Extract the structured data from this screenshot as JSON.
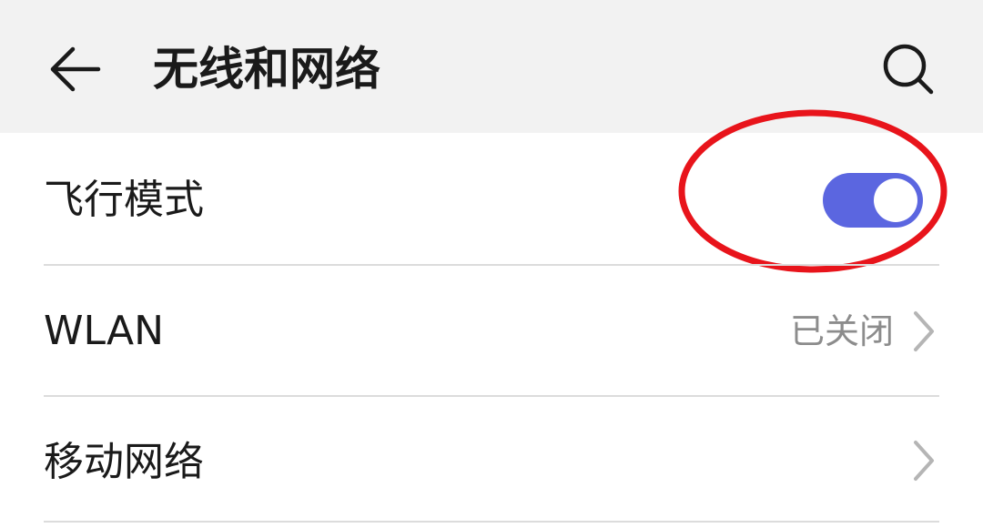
{
  "header": {
    "title": "无线和网络",
    "back_icon": "arrow-left-icon",
    "search_icon": "search-icon"
  },
  "settings": [
    {
      "label": "飞行模式",
      "control": "toggle",
      "on": true
    },
    {
      "label": "WLAN",
      "status": "已关闭",
      "control": "chevron"
    },
    {
      "label": "移动网络",
      "control": "chevron"
    }
  ],
  "colors": {
    "header_bg": "#f2f2f2",
    "toggle_on": "#5b66e0",
    "annotation": "#e8141b",
    "status_text": "#8c8c8c",
    "divider": "#dcdcdc"
  }
}
